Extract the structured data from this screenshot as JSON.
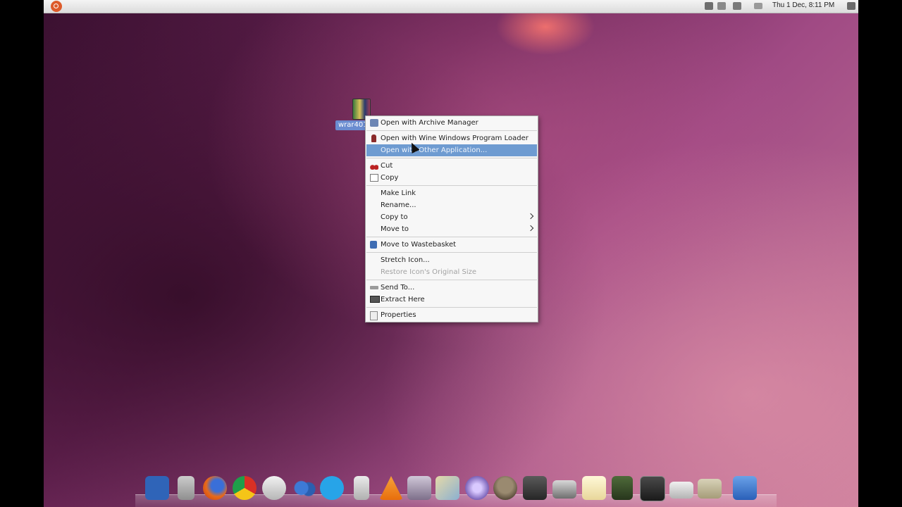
{
  "panel": {
    "clock": "Thu  1 Dec,  8:11 PM"
  },
  "desktop": {
    "file_label": "wrar401"
  },
  "context_menu": {
    "items": [
      {
        "label": "Open with Archive Manager",
        "icon": "archive-manager-icon"
      },
      {
        "label": "Open with Wine Windows Program Loader",
        "icon": "wine-glass-icon"
      },
      {
        "label": "Open with Other Application...",
        "highlighted": true
      },
      {
        "label": "Cut",
        "icon": "scissors-icon"
      },
      {
        "label": "Copy",
        "icon": "copy-icon"
      },
      {
        "label": "Make Link"
      },
      {
        "label": "Rename..."
      },
      {
        "label": "Copy to",
        "submenu": true
      },
      {
        "label": "Move to",
        "submenu": true
      },
      {
        "label": "Move to Wastebasket",
        "icon": "wastebasket-icon"
      },
      {
        "label": "Stretch Icon..."
      },
      {
        "label": "Restore Icon's Original Size",
        "disabled": true
      },
      {
        "label": "Send To...",
        "icon": "send-to-icon"
      },
      {
        "label": "Extract Here",
        "icon": "extract-icon"
      },
      {
        "label": "Properties",
        "icon": "properties-icon"
      }
    ]
  },
  "dock": {
    "icons": [
      "anchor-icon",
      "file-cabinet-icon",
      "firefox-icon",
      "chrome-icon",
      "mail-clock-icon",
      "bubbles-icon",
      "skype-icon",
      "media-player-icon",
      "vlc-icon",
      "screenshot-icon",
      "image-viewer-icon",
      "aperture-icon",
      "gimp-icon",
      "camera-icon",
      "scanner-icon",
      "text-editor-icon",
      "calculator-icon",
      "terminal-icon",
      "keyboard-icon",
      "folder-icon",
      "trash-icon"
    ]
  },
  "colors": {
    "highlight": "#6e9bd1",
    "wallpaper_dark": "#3a1030",
    "wallpaper_light": "#c87a9a"
  }
}
